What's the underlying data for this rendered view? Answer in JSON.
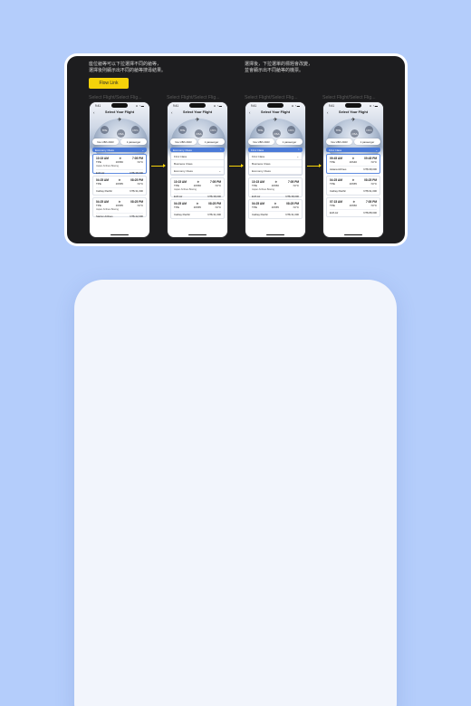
{
  "notes": {
    "left": "座位艙等可以下拉選擇不同的艙等，\n選擇後則顯示出不同的艙等搜尋結果。",
    "right": "選擇後，下拉選單的標題會改變，\n並會顯示出不同艙等的機票。"
  },
  "flow_link_label": "Flow Link",
  "frame_label": "Select Flight/Select Flig...",
  "phone": {
    "time": "9:41",
    "signal": "▪▪ ◔ ▬",
    "back": "‹",
    "title": "Select Your Flight",
    "plane": "✈",
    "cities": [
      "TPE",
      "NYC",
      "OSA"
    ],
    "date_chip": "Nov 28th 2023",
    "passenger_chip": "1 passenger",
    "chevron_down": "⌄",
    "chevron_up": "⌃"
  },
  "screens": [
    {
      "selected_class": "Economy Class",
      "flights": [
        {
          "dep_time": "10:15 AM",
          "arr_time": "7:05 PM",
          "from": "TPE",
          "duration": "16h50",
          "to": "NYC",
          "airline": "Japan Airlines Boeing",
          "class": "EVA Air",
          "price": "NT$ 38,000"
        },
        {
          "dep_time": "04:25 AM",
          "arr_time": "08:25 PM",
          "from": "TPE",
          "duration": "16h55",
          "to": "NYC",
          "airline": "",
          "class": "Cathay Pacific",
          "price": "NT$ 31,000"
        },
        {
          "dep_time": "04:25 AM",
          "arr_time": "08:25 PM",
          "from": "TPE",
          "duration": "16h55",
          "to": "NYC",
          "airline": "Japan Airlines Boeing",
          "class": "Starlux Airlines",
          "price": "NT$ 42,000"
        }
      ]
    },
    {
      "selected_class": "Economy Class",
      "dropdown": [
        "First Class",
        "Business Class",
        "Economy Class"
      ]
    },
    {
      "selected_class": "First Class",
      "dropdown": [
        "First Class",
        "Business Class",
        "Economy Class"
      ]
    },
    {
      "selected_class": "First Class",
      "flights": [
        {
          "dep_time": "09:45 AM",
          "arr_time": "09:45 PM",
          "from": "TPE",
          "duration": "16h40",
          "to": "NYC",
          "airline": "",
          "class": "Asiana Airlines",
          "price": "NT$ 98,000"
        },
        {
          "dep_time": "04:25 AM",
          "arr_time": "08:25 PM",
          "from": "TPE",
          "duration": "16h55",
          "to": "NYC",
          "airline": "",
          "class": "Cathay Pacific",
          "price": "NT$ 91,000"
        },
        {
          "dep_time": "07:15 AM",
          "arr_time": "7:05 PM",
          "from": "TPE",
          "duration": "16h50",
          "to": "NYC",
          "airline": "",
          "class": "EVA Air",
          "price": "NT$ 88,000"
        }
      ]
    }
  ],
  "colors": {
    "background": "#b4cdfb",
    "board": "#1d1d1f",
    "accent": "#f5d20a",
    "select_blue": "#4b7bd8",
    "panel": "#f2f5fc"
  }
}
